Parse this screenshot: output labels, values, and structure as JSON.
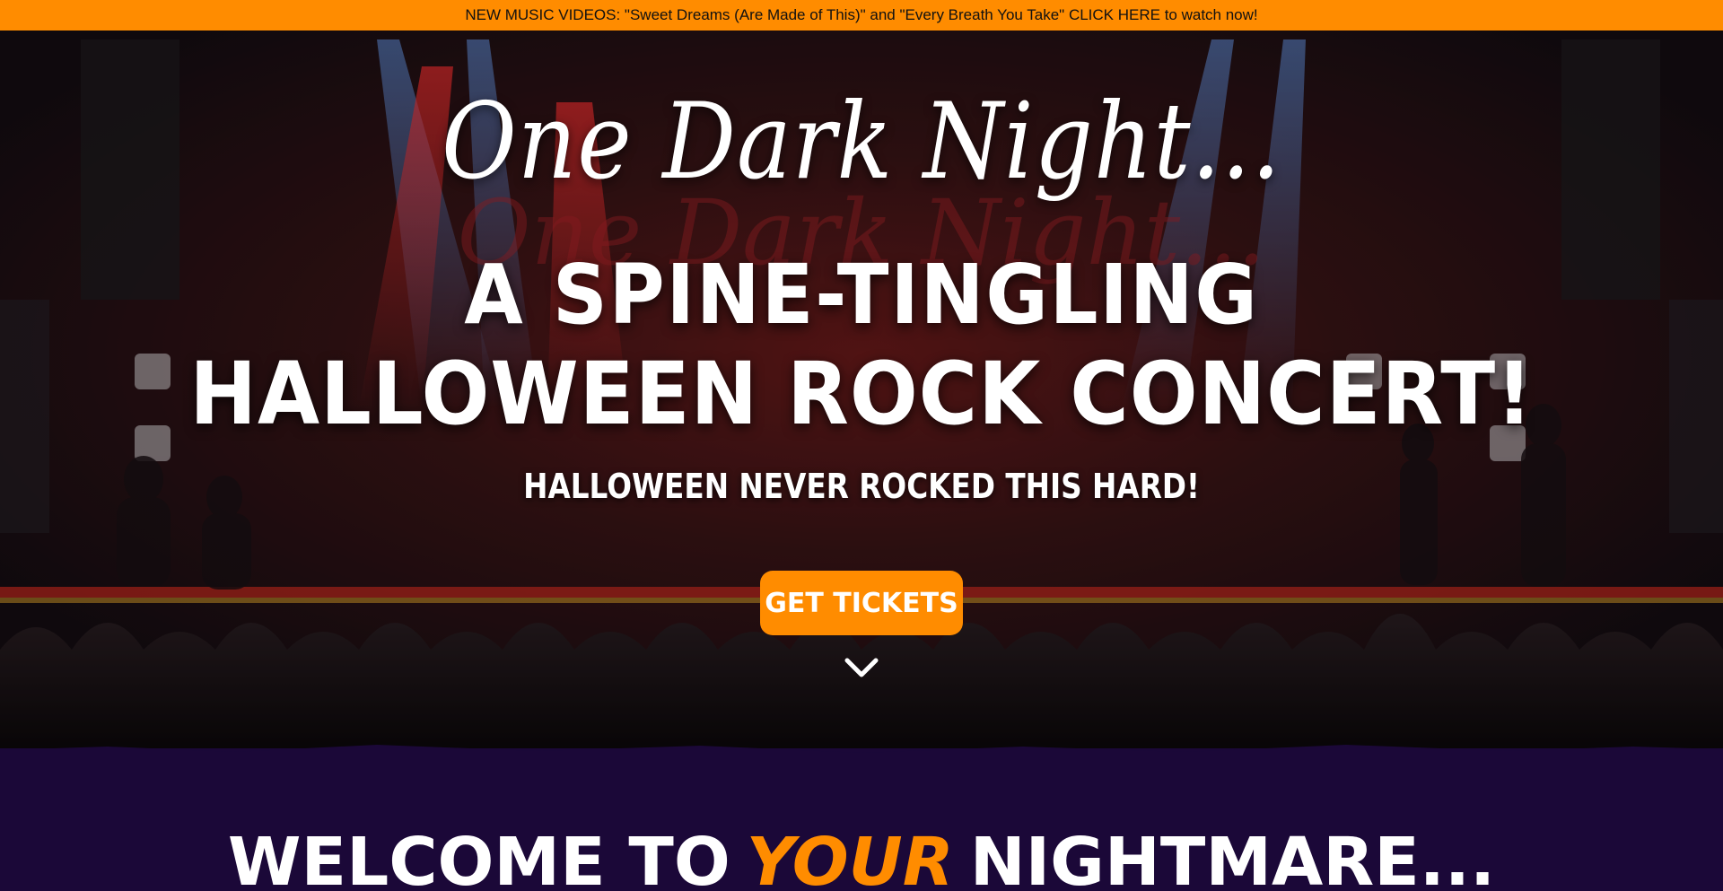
{
  "announcement": {
    "text": "NEW MUSIC VIDEOS: \"Sweet Dreams (Are Made of This)\" and \"Every Breath You Take\" CLICK HERE to watch now!"
  },
  "hero": {
    "logo": "One Dark Night...",
    "headline_line1": "A Spine-Tingling",
    "headline_line2": "Halloween Rock Concert!",
    "tagline": "Halloween Never Rocked This Hard!",
    "cta_label": "Get Tickets",
    "scroll_icon": "chevron-down-icon"
  },
  "welcome": {
    "before": "Welcome to",
    "accent": "Your",
    "after": "Nightmare..."
  },
  "colors": {
    "accent": "#ff8c00",
    "section_bg": "#1b0838",
    "text": "#ffffff"
  }
}
